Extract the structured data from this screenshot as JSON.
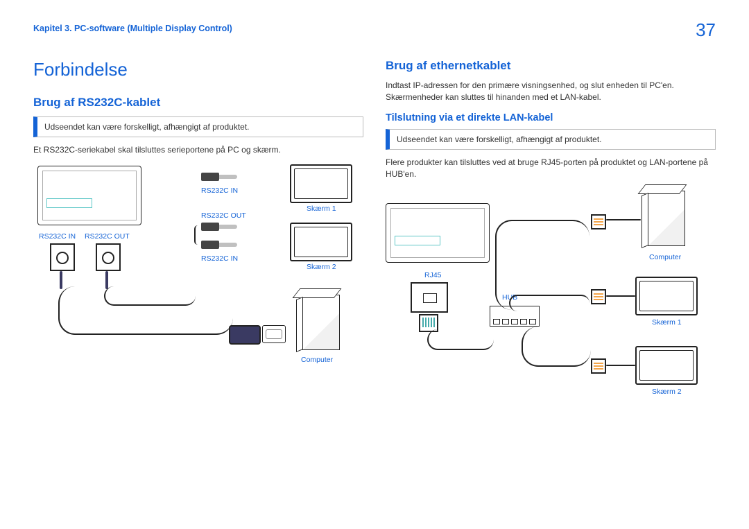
{
  "header": {
    "chapter_label": "Kapitel 3. PC-software (Multiple Display Control)",
    "page_number": "37"
  },
  "left": {
    "h1": "Forbindelse",
    "h2": "Brug af RS232C-kablet",
    "note": "Udseendet kan være forskelligt, afhængigt af produktet.",
    "body": "Et RS232C-seriekabel skal tilsluttes serieportene på PC og skærm.",
    "labels": {
      "rs232c_in": "RS232C IN",
      "rs232c_out": "RS232C OUT",
      "skaerm1": "Skærm 1",
      "skaerm2": "Skærm 2",
      "computer": "Computer"
    }
  },
  "right": {
    "h2": "Brug af ethernetkablet",
    "body1": "Indtast IP-adressen for den primære visningsenhed, og slut enheden til PC'en. Skærmenheder kan sluttes til hinanden med et LAN-kabel.",
    "h3": "Tilslutning via et direkte LAN-kabel",
    "note": "Udseendet kan være forskelligt, afhængigt af produktet.",
    "body2": "Flere produkter kan tilsluttes ved at bruge RJ45-porten på produktet og LAN-portene på HUB'en.",
    "labels": {
      "rj45": "RJ45",
      "hub": "HUB",
      "computer": "Computer",
      "skaerm1": "Skærm 1",
      "skaerm2": "Skærm 2"
    }
  }
}
